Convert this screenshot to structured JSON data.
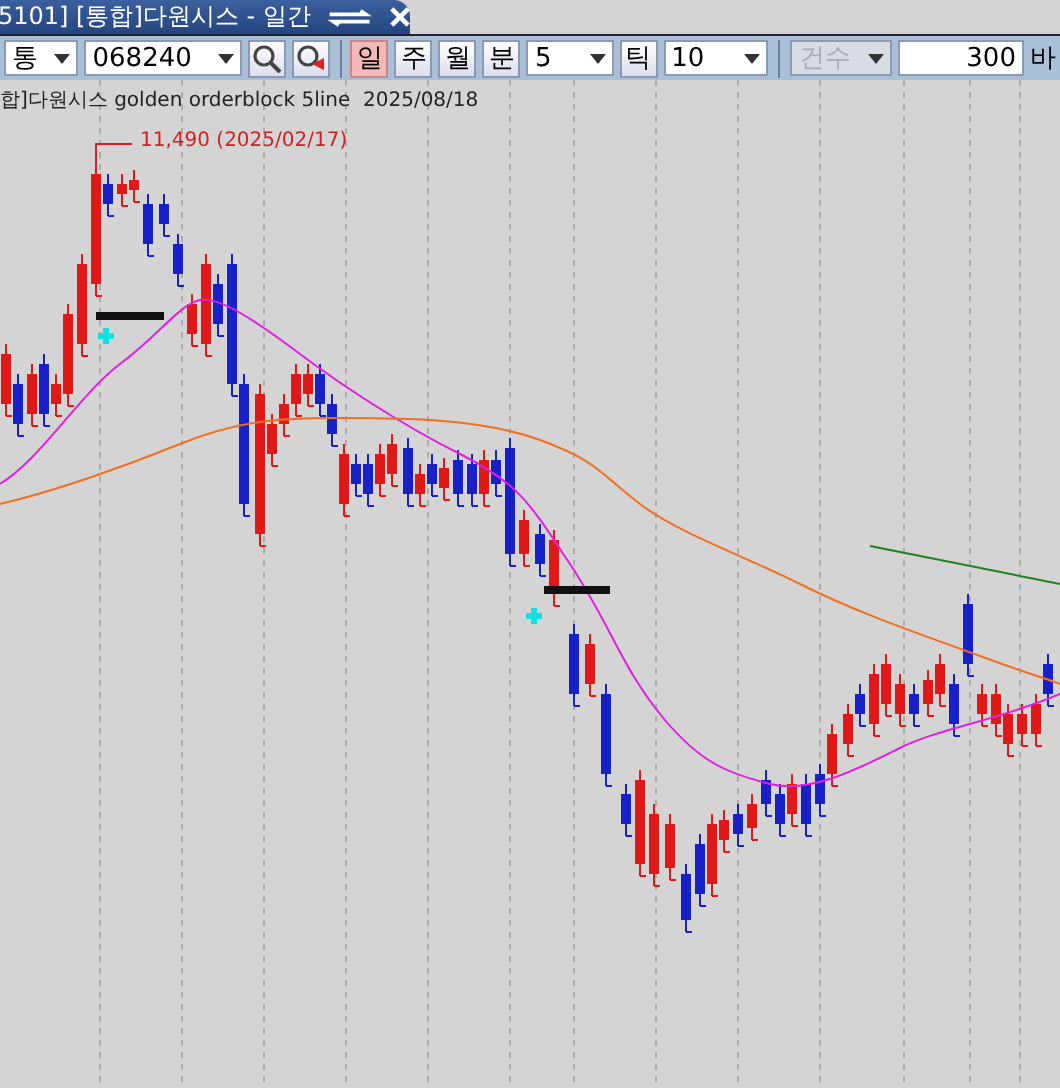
{
  "window": {
    "title": "5101] [통합]다원시스 - 일간"
  },
  "toolbar": {
    "market": {
      "value": "통"
    },
    "code": {
      "value": "068240"
    },
    "periods": [
      {
        "label": "일",
        "selected": true
      },
      {
        "label": "주",
        "selected": false
      },
      {
        "label": "월",
        "selected": false
      },
      {
        "label": "분",
        "selected": false
      }
    ],
    "minute": {
      "value": "5"
    },
    "tick": {
      "label": "틱",
      "value": "10"
    },
    "count": {
      "label": "건수",
      "disabled": true
    },
    "bars": {
      "value": "300",
      "unit": "바"
    }
  },
  "chart": {
    "header": "합]다원시스 golden orderblock 5line",
    "date": "2025/08/18",
    "high_label": "11,490 (2025/02/17)"
  }
}
